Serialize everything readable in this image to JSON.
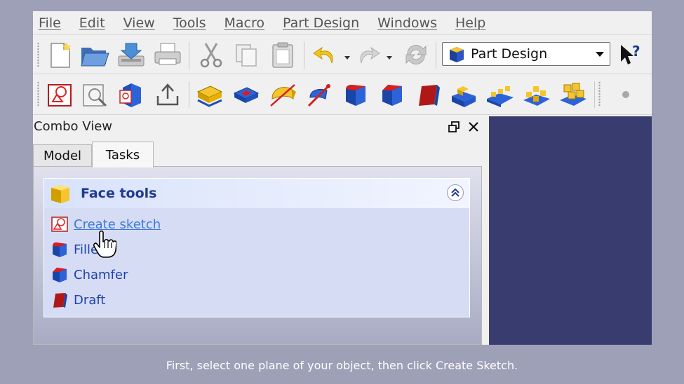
{
  "menubar": {
    "items": [
      "File",
      "Edit",
      "View",
      "Tools",
      "Macro",
      "Part Design",
      "Windows",
      "Help"
    ]
  },
  "toolbar": {
    "workbench_selected": "Part Design"
  },
  "combo_view": {
    "title": "Combo View",
    "tabs": [
      "Model",
      "Tasks"
    ],
    "active_tab": "Tasks"
  },
  "task_panel": {
    "header": "Face tools",
    "items": [
      "Create sketch",
      "Fillet",
      "Chamfer",
      "Draft"
    ]
  },
  "caption": "First, select one plane of your object, then click Create Sketch.",
  "colors": {
    "accent_link": "#3c78d8",
    "task_text": "#2144a8",
    "view3d_bg": "#393c6e",
    "outer_bg": "#9ea0b8"
  }
}
